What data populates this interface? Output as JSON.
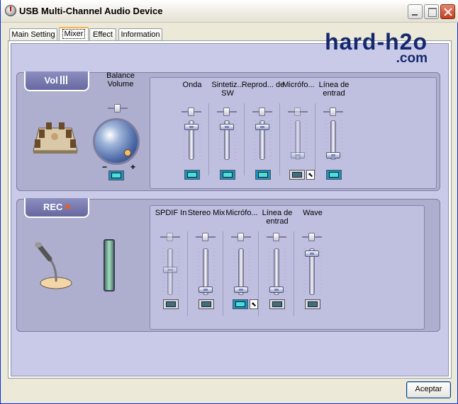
{
  "window": {
    "title": "USB Multi-Channel Audio Device"
  },
  "tabs": [
    {
      "label": "Main Setting"
    },
    {
      "label": "Mixer",
      "active": true
    },
    {
      "label": "Effect"
    },
    {
      "label": "Information"
    }
  ],
  "logo": {
    "line1": "hard-h2o",
    "line2": ".com"
  },
  "playback": {
    "section_label": "Vol",
    "balance_label": "Balance Volume",
    "dial_minus": "−",
    "dial_plus": "+",
    "volume_muted": false,
    "channels": [
      {
        "label": "Onda",
        "level": 0.9,
        "muted": false,
        "enabled": true
      },
      {
        "label": "Sintetiz... SW",
        "level": 0.9,
        "muted": false,
        "enabled": true
      },
      {
        "label": "Reprod... de",
        "level": 0.9,
        "muted": false,
        "enabled": true
      },
      {
        "label": "Micrófo...",
        "level": 0.05,
        "muted": true,
        "enabled": false,
        "select_icon": "record-select-icon"
      },
      {
        "label": "Línea de entrad",
        "level": 0.05,
        "muted": false,
        "enabled": true
      }
    ]
  },
  "recording": {
    "section_label": "REC",
    "channels": [
      {
        "label": "SPDIF In",
        "level": 0.55,
        "muted": true,
        "enabled": false
      },
      {
        "label": "Stereo Mix",
        "level": 0.05,
        "muted": true,
        "enabled": true
      },
      {
        "label": "Micrófo...",
        "level": 0.05,
        "muted": false,
        "enabled": true,
        "select_icon": "record-select-icon"
      },
      {
        "label": "Línea de entrad",
        "level": 0.05,
        "muted": true,
        "enabled": true
      },
      {
        "label": "Wave",
        "level": 0.95,
        "muted": true,
        "enabled": true
      }
    ]
  },
  "buttons": {
    "ok": "Aceptar"
  },
  "colors": {
    "accent": "#15286d",
    "panel": "#c9cae8",
    "section": "#aeafcf"
  }
}
